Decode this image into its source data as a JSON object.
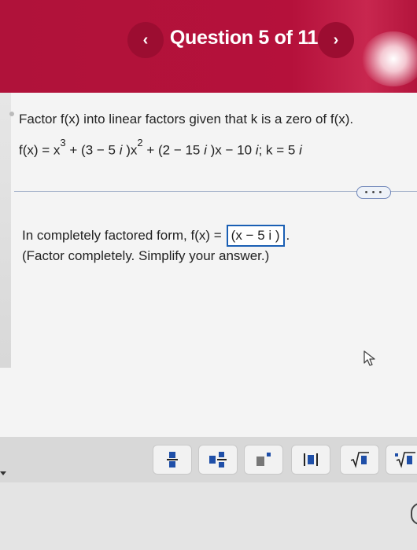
{
  "header": {
    "title": "Question 5 of 11",
    "prev_glyph": "‹",
    "next_glyph": "›",
    "color": "#b0123a"
  },
  "question": {
    "prompt": "Factor f(x) into linear factors given that k is a zero of f(x).",
    "equation": {
      "part1": "f(x) = x",
      "exp1": "3",
      "part2": " + (3 − 5 ",
      "i1": "i",
      "part3": " )x",
      "exp2": "2",
      "part4": " + (2 − 15 ",
      "i2": "i",
      "part5": " )x − 10 ",
      "i3": "i",
      "part6": "; k = 5 ",
      "i4": "i"
    }
  },
  "more_button": "• • •",
  "answer": {
    "prefix": "In completely factored form, f(x) =",
    "value": "(x − 5 i )",
    "suffix": ".",
    "instructions": "(Factor completely. Simplify your answer.)"
  },
  "toolbar": {
    "tools": [
      {
        "name": "fraction-icon"
      },
      {
        "name": "mixed-number-icon"
      },
      {
        "name": "exponent-icon"
      },
      {
        "name": "absolute-value-icon"
      },
      {
        "name": "square-root-icon"
      },
      {
        "name": "nth-root-icon"
      }
    ]
  }
}
